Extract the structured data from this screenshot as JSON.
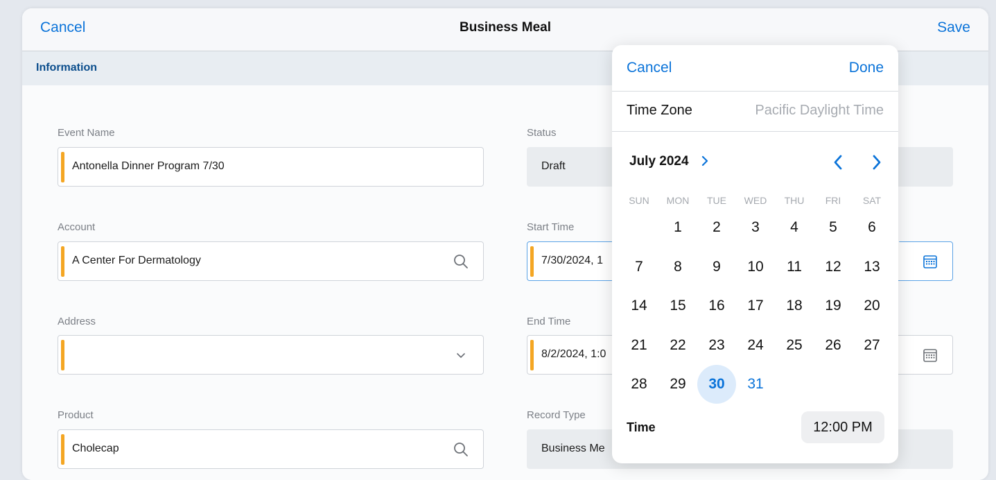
{
  "nav": {
    "cancel": "Cancel",
    "title": "Business Meal",
    "save": "Save"
  },
  "section": {
    "title": "Information"
  },
  "fields": {
    "event_name": {
      "label": "Event Name",
      "value": "Antonella Dinner Program 7/30"
    },
    "account": {
      "label": "Account",
      "value": "A Center For Dermatology",
      "icon": "search-icon"
    },
    "address": {
      "label": "Address",
      "value": "",
      "icon": "chevron-down-icon"
    },
    "product": {
      "label": "Product",
      "value": "Cholecap",
      "icon": "search-icon"
    },
    "status": {
      "label": "Status",
      "value": "Draft"
    },
    "start_time": {
      "label": "Start Time",
      "value": "7/30/2024, 1",
      "icon": "calendar-icon"
    },
    "end_time": {
      "label": "End Time",
      "value": "8/2/2024, 1:0",
      "icon": "calendar-icon"
    },
    "record_type": {
      "label": "Record Type",
      "value": "Business Me"
    }
  },
  "picker": {
    "cancel": "Cancel",
    "done": "Done",
    "time_zone_label": "Time Zone",
    "time_zone_value": "Pacific Daylight Time",
    "month": "July 2024",
    "weekdays": [
      "SUN",
      "MON",
      "TUE",
      "WED",
      "THU",
      "FRI",
      "SAT"
    ],
    "days": [
      "1",
      "2",
      "3",
      "4",
      "5",
      "6",
      "7",
      "8",
      "9",
      "10",
      "11",
      "12",
      "13",
      "14",
      "15",
      "16",
      "17",
      "18",
      "19",
      "20",
      "21",
      "22",
      "23",
      "24",
      "25",
      "26",
      "27",
      "28",
      "29",
      "30",
      "31"
    ],
    "first_weekday_index": 1,
    "selected_day": "30",
    "time_label": "Time",
    "time_value": "12:00 PM"
  },
  "colors": {
    "accent": "#0a73d9",
    "required": "#f4a623",
    "selected_bg": "#dcebfb"
  }
}
